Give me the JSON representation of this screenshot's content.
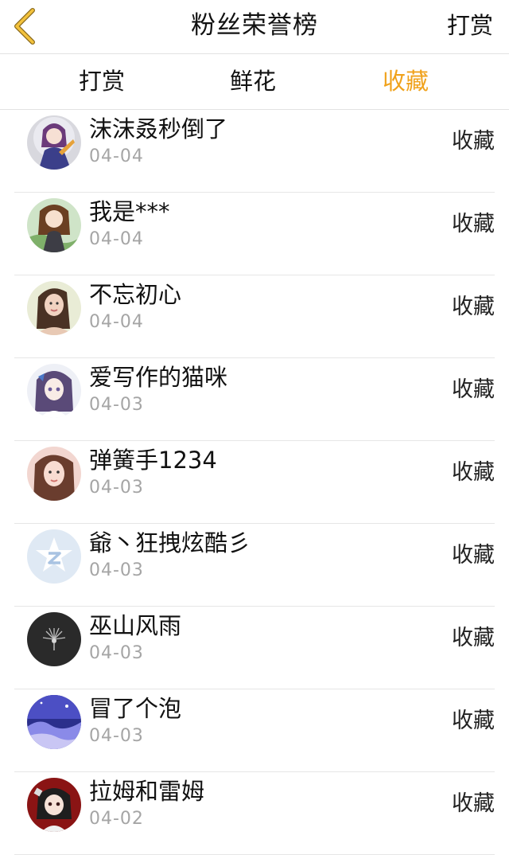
{
  "header": {
    "title": "粉丝荣誉榜",
    "action_label": "打赏",
    "back_icon": "chevron-left-icon",
    "accent_color": "#f0a21c"
  },
  "tabs": [
    {
      "label": "打赏",
      "active": false
    },
    {
      "label": "鲜花",
      "active": false
    },
    {
      "label": "收藏",
      "active": true
    }
  ],
  "fans": [
    {
      "name": "沫沫叒秒倒了",
      "date": "04-04",
      "action": "收藏",
      "avatar": "anime-girl-purple"
    },
    {
      "name": "我是***",
      "date": "04-04",
      "action": "收藏",
      "avatar": "anime-girl-brown-hair"
    },
    {
      "name": "不忘初心",
      "date": "04-04",
      "action": "收藏",
      "avatar": "woman-photo"
    },
    {
      "name": "爱写作的猫咪",
      "date": "04-03",
      "action": "收藏",
      "avatar": "anime-girl-white"
    },
    {
      "name": "弹簧手1234",
      "date": "04-03",
      "action": "收藏",
      "avatar": "woman-selfie"
    },
    {
      "name": "爺丶狂拽炫酷彡",
      "date": "04-03",
      "action": "收藏",
      "avatar": "qq-default"
    },
    {
      "name": "巫山风雨",
      "date": "04-03",
      "action": "收藏",
      "avatar": "dark-firework"
    },
    {
      "name": "冒了个泡",
      "date": "04-03",
      "action": "收藏",
      "avatar": "purple-landscape"
    },
    {
      "name": "拉姆和雷姆",
      "date": "04-02",
      "action": "收藏",
      "avatar": "red-anime-character"
    }
  ]
}
